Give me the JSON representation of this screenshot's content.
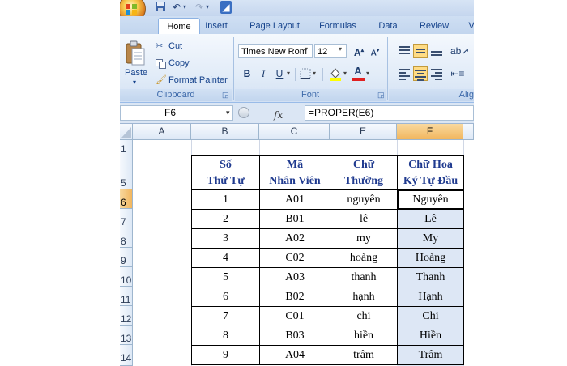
{
  "ribbon_tabs": [
    "Home",
    "Insert",
    "Page Layout",
    "Formulas",
    "Data",
    "Review",
    "V"
  ],
  "clipboard": {
    "paste": "Paste",
    "cut": "Cut",
    "copy": "Copy",
    "format_painter": "Format Painter",
    "group": "Clipboard"
  },
  "font": {
    "name": "Times New Rom",
    "size": "12",
    "bold": "B",
    "italic": "I",
    "underline": "U",
    "group": "Font"
  },
  "alignment": {
    "group": "Alig"
  },
  "formula_bar": {
    "name_box": "F6",
    "fx": "fx",
    "formula": "=PROPER(E6)"
  },
  "columns": [
    "A",
    "B",
    "C",
    "E",
    "F"
  ],
  "selected_column": "F",
  "selected_row": "6",
  "header_rows": [
    "1",
    "5"
  ],
  "headers": {
    "b": [
      "Số",
      "Thứ Tự"
    ],
    "c": [
      "Mã",
      "Nhân Viên"
    ],
    "e": [
      "Chữ",
      "Thường"
    ],
    "f": [
      "Chữ Hoa",
      "Ký Tự Đầu"
    ]
  },
  "rows": [
    {
      "row": "6",
      "stt": "1",
      "ma": "A01",
      "thuong": "nguyên",
      "hoa": "Nguyên"
    },
    {
      "row": "7",
      "stt": "2",
      "ma": "B01",
      "thuong": "lê",
      "hoa": "Lê"
    },
    {
      "row": "8",
      "stt": "3",
      "ma": "A02",
      "thuong": "my",
      "hoa": "My"
    },
    {
      "row": "9",
      "stt": "4",
      "ma": "C02",
      "thuong": "hoàng",
      "hoa": "Hoàng"
    },
    {
      "row": "10",
      "stt": "5",
      "ma": "A03",
      "thuong": "thanh",
      "hoa": "Thanh"
    },
    {
      "row": "11",
      "stt": "6",
      "ma": "B02",
      "thuong": "hạnh",
      "hoa": "Hạnh"
    },
    {
      "row": "12",
      "stt": "7",
      "ma": "C01",
      "thuong": "chi",
      "hoa": "Chi"
    },
    {
      "row": "13",
      "stt": "8",
      "ma": "B03",
      "thuong": "hiền",
      "hoa": "Hiền"
    },
    {
      "row": "14",
      "stt": "9",
      "ma": "A04",
      "thuong": "trâm",
      "hoa": "Trâm"
    }
  ],
  "colors": {
    "accent": "#f1b65e",
    "header_text": "#1f3a8f",
    "ribbon_text": "#15428b"
  }
}
